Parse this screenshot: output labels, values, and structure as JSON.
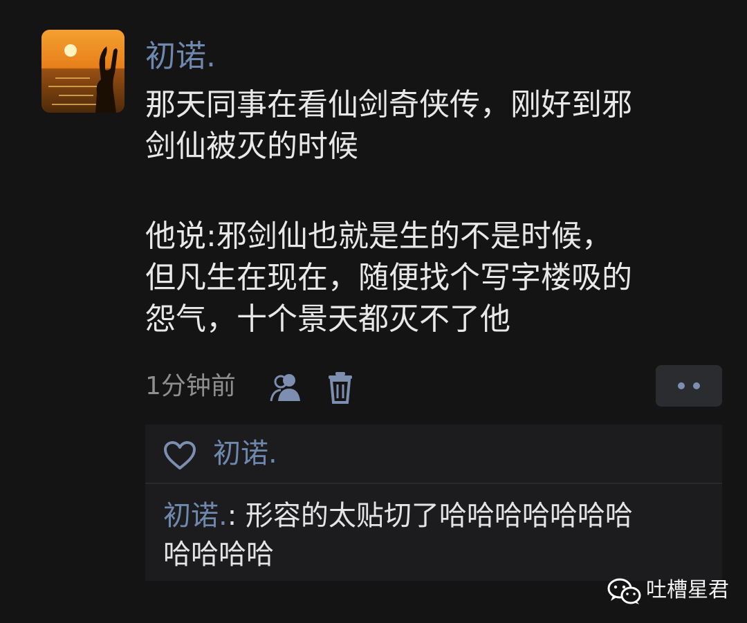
{
  "post": {
    "author": "初诺.",
    "body_lines": [
      "那天同事在看仙剑奇侠传，刚好到邪",
      "剑仙被灭的时候",
      "他说:邪剑仙也就是生的不是时候，",
      "但凡生在现在，随便找个写字楼吸的",
      "怨气，十个景天都灭不了他"
    ],
    "timestamp": "1分钟前"
  },
  "likes": {
    "names": "初诺."
  },
  "comment": {
    "author": "初诺.",
    "separator": ":",
    "text_line1": " 形容的太贴切了哈哈哈哈哈哈哈",
    "text_line2": "哈哈哈哈"
  },
  "watermark": {
    "text": "吐槽星君"
  },
  "icons": {
    "visibility": "people-icon",
    "delete": "trash-icon",
    "like": "heart-icon",
    "more": "more-dots-icon",
    "watermark": "wechat-icon"
  },
  "colors": {
    "background": "#141414",
    "name_link": "#6f88ad",
    "body_text": "#e8e8e8",
    "meta_text": "#8f8f8f",
    "comment_bg": "#1c1c1e"
  }
}
